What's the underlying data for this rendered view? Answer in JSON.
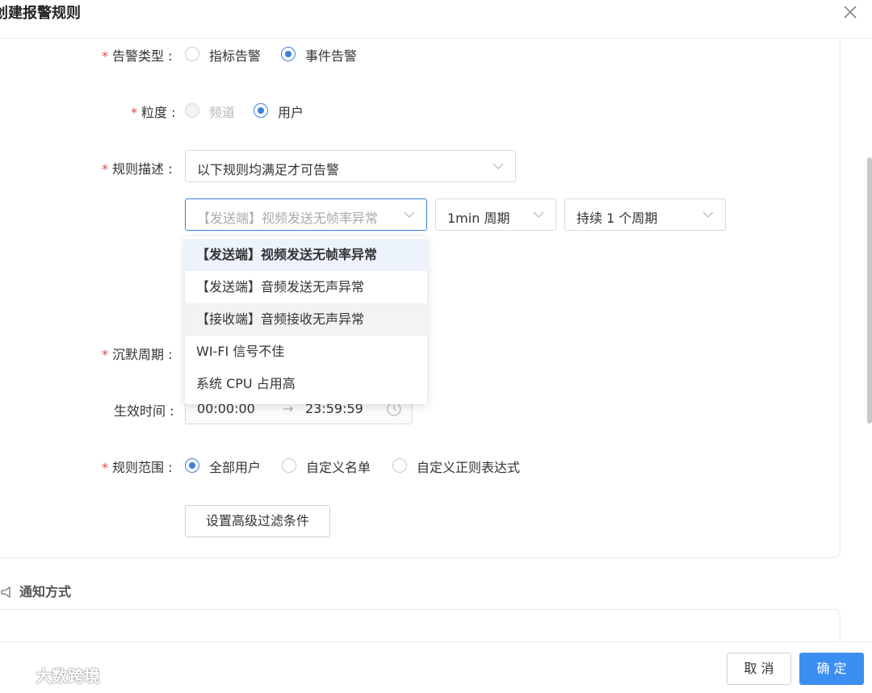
{
  "dialog": {
    "title": "创建报警规则"
  },
  "form": {
    "alert_type": {
      "label": "告警类型 :",
      "options": [
        "指标告警",
        "事件告警"
      ],
      "selected": "事件告警"
    },
    "granularity": {
      "label": "粒度 :",
      "options": [
        "频道",
        "用户"
      ],
      "selected": "用户",
      "disabled": "频道"
    },
    "rule_desc": {
      "label": "规则描述 :",
      "condition_select": "以下规则均满足才可告警",
      "event_select_placeholder": "【发送端】视频发送无帧率异常",
      "period_select": "1min 周期",
      "duration_select": "持续 1 个周期"
    },
    "silence_period": {
      "label": "沉默周期 :"
    },
    "effective_time": {
      "label": "生效时间 :",
      "start": "00:00:00",
      "arrow": "→",
      "end": "23:59:59"
    },
    "rule_scope": {
      "label": "规则范围 :",
      "options": [
        "全部用户",
        "自定义名单",
        "自定义正则表达式"
      ],
      "selected": "全部用户"
    },
    "advanced_filter_button": "设置高级过滤条件"
  },
  "dropdown": {
    "options": [
      {
        "label": "【发送端】视频发送无帧率异常",
        "state": "selected"
      },
      {
        "label": "【发送端】音频发送无声异常",
        "state": ""
      },
      {
        "label": "【接收端】音频接收无声异常",
        "state": "hover"
      },
      {
        "label": "WI-FI 信号不佳",
        "state": ""
      },
      {
        "label": "系统 CPU 占用高",
        "state": ""
      }
    ]
  },
  "notify": {
    "title": "通知方式"
  },
  "footer": {
    "cancel": "取 消",
    "confirm": "确 定"
  },
  "watermark": "大数跨境",
  "colors": {
    "primary": "#3b8ff0",
    "required": "#e5484d",
    "radio_on": "#3b7fe0"
  }
}
